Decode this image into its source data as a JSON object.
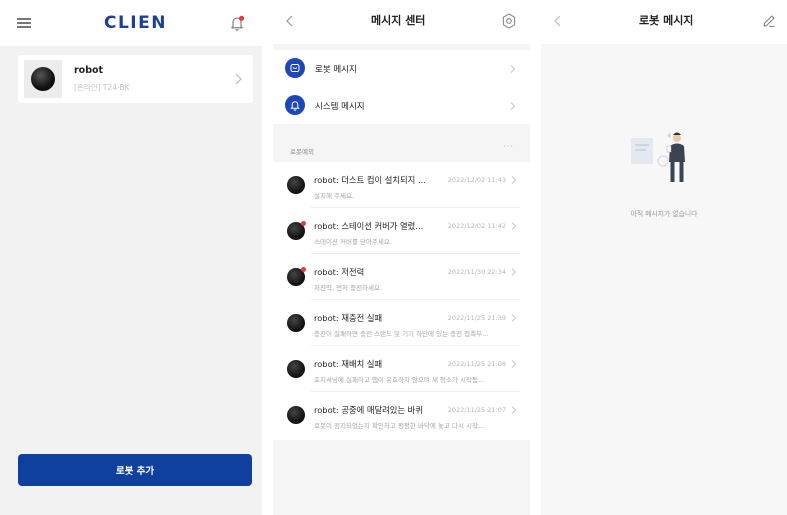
{
  "home": {
    "logo": "CLIEN",
    "robot": {
      "name": "robot",
      "status": "[온라인] T24-BK"
    },
    "add_robot_button": "로봇 추가"
  },
  "message_center": {
    "title": "메시지 센터",
    "categories": [
      {
        "label": "로봇 메시지",
        "icon": "robot-icon"
      },
      {
        "label": "시스템 메시지",
        "icon": "bell-icon"
      }
    ],
    "section_title": "로봇예외",
    "section_more": "···",
    "messages": [
      {
        "title": "robot: 더스트 컵이 설치되지 ...",
        "subtitle": "설치해 주세요.",
        "time": "2022/12/02 11:43",
        "unread": false
      },
      {
        "title": "robot: 스테이션 커버가 열렸...",
        "subtitle": "스테이션 커버를 닫아주세요.",
        "time": "2022/12/02 11:42",
        "unread": true
      },
      {
        "title": "robot: 저전력",
        "subtitle": "저전력, 먼저 충전하세요.",
        "time": "2022/11/30 22:34",
        "unread": true
      },
      {
        "title": "robot: 재충전 실패",
        "subtitle": "충전이 실패하면 충전 스탠드 및 기기 하단에 있는 충전 접촉부...",
        "time": "2022/11/25 21:39",
        "unread": false
      },
      {
        "title": "robot: 재배치 실패",
        "subtitle": "포지셔닝에 실패하고 맵이 유효하지 않으며 새 청소가 시작됨...",
        "time": "2022/11/25 21:08",
        "unread": false
      },
      {
        "title": "robot: 공중에 매달려있는 바퀴",
        "subtitle": "로봇이 정지되었는지 확인하고 평평한 바닥에 놓고 다시 시작...",
        "time": "2022/11/25 21:07",
        "unread": false
      }
    ]
  },
  "robot_messages": {
    "title": "로봇 메시지",
    "empty_text": "아직 메시지가 없습니다"
  },
  "colors": {
    "brand": "#1d3f9c",
    "button": "#10409e",
    "category_icon": "#1d46b8",
    "unread_dot": "#e23b3b"
  }
}
